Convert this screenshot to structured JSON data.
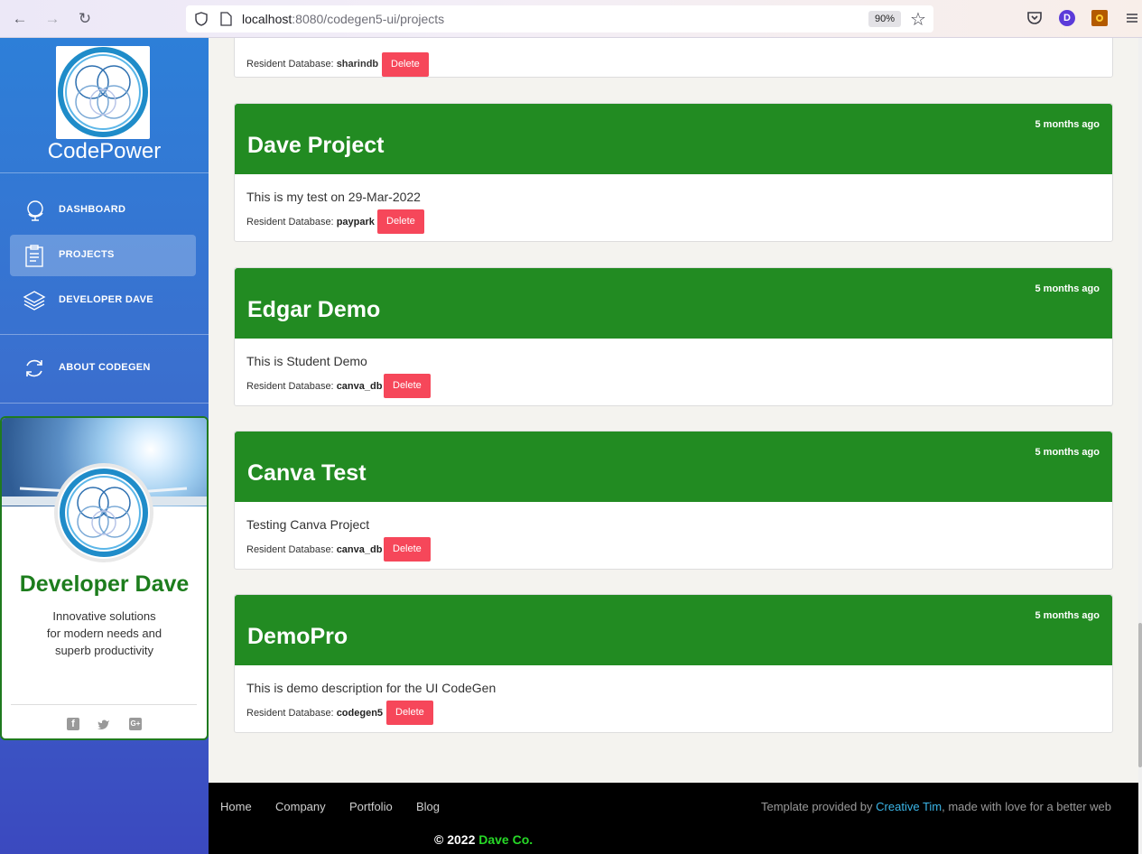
{
  "browser": {
    "url_host": "localhost",
    "url_rest": ":8080/codegen5-ui/projects",
    "zoom": "90%",
    "profile_initial": "D"
  },
  "sidebar": {
    "brand": "CodePower",
    "nav": [
      {
        "label": "DASHBOARD",
        "icon": "globe-icon"
      },
      {
        "label": "PROJECTS",
        "icon": "clipboard-icon",
        "active": true
      },
      {
        "label": "DEVELOPER DAVE",
        "icon": "layers-icon"
      },
      {
        "label": "ABOUT CODEGEN",
        "icon": "refresh-icon"
      }
    ],
    "profile": {
      "name": "Developer Dave",
      "desc": [
        "Innovative solutions",
        "for modern needs and",
        "superb productivity"
      ]
    }
  },
  "projects": {
    "partial": {
      "db_label": "Resident Database:",
      "db": "sharindb",
      "delete": "Delete"
    },
    "cards": [
      {
        "title": "Dave Project",
        "time": "5 months ago",
        "desc": "This is my test on 29-Mar-2022",
        "db_label": "Resident Database:",
        "db": "paypark",
        "delete": "Delete"
      },
      {
        "title": "Edgar Demo",
        "time": "5 months ago",
        "desc": "This is Student Demo",
        "db_label": "Resident Database:",
        "db": "canva_db",
        "delete": "Delete"
      },
      {
        "title": "Canva Test",
        "time": "5 months ago",
        "desc": "Testing Canva Project",
        "db_label": "Resident Database:",
        "db": "canva_db",
        "delete": "Delete"
      },
      {
        "title": "DemoPro",
        "time": "5 months ago",
        "desc": "This is demo description for the UI CodeGen",
        "db_label": "Resident Database:",
        "db": "codegen5",
        "delete": "Delete"
      }
    ]
  },
  "footer": {
    "links": [
      "Home",
      "Company",
      "Portfolio",
      "Blog"
    ],
    "credit_pre": "Template provided by ",
    "credit_link": "Creative Tim",
    "credit_post": ", made with love for a better web",
    "copyright_pre": "© 2022 ",
    "copyright_co": "Dave Co."
  },
  "colors": {
    "header_green": "#228b22",
    "delete_red": "#f6475a",
    "sidebar_blue": "#3a70cf",
    "profile_name_green": "#1d7d1d"
  }
}
